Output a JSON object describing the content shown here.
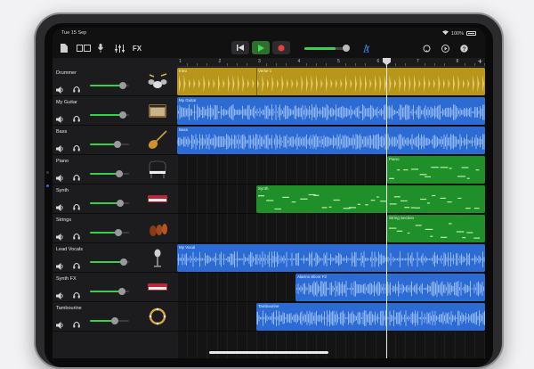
{
  "status": {
    "time": "Tue 15 Sep",
    "battery": "100%"
  },
  "toolbar": {
    "fx_label": "FX",
    "master_volume": 0.8,
    "colors": {
      "record": "#e5403a",
      "play": "#39d24a",
      "accent": "#2f6dd6"
    },
    "icons": [
      "document-icon",
      "view-toggle-icon",
      "microphone-icon",
      "mixer-icon",
      "rewind-icon",
      "play-icon",
      "record-icon",
      "metronome-icon",
      "loop-icon",
      "settings-icon",
      "help-icon"
    ]
  },
  "ruler": {
    "bars": [
      "1",
      "2",
      "3",
      "4",
      "5",
      "6",
      "7",
      "8"
    ]
  },
  "tracks": [
    {
      "name": "Drummer",
      "volume": 0.8,
      "icon": "drum-kit-icon",
      "color": "#b8961c"
    },
    {
      "name": "My Guitar",
      "volume": 0.8,
      "icon": "amp-icon",
      "color": "#2c6bd4"
    },
    {
      "name": "Bass",
      "volume": 0.65,
      "icon": "bass-guitar-icon",
      "color": "#2c6bd4"
    },
    {
      "name": "Piano",
      "volume": 0.7,
      "icon": "grand-piano-icon",
      "color": "#1f8f2a"
    },
    {
      "name": "Synth",
      "volume": 0.72,
      "icon": "synth-keyboard-icon",
      "color": "#1f8f2a"
    },
    {
      "name": "Strings",
      "volume": 0.68,
      "icon": "violin-icon",
      "color": "#1f8f2a"
    },
    {
      "name": "Lead Vocals",
      "volume": 0.82,
      "icon": "microphone-icon",
      "color": "#2c6bd4"
    },
    {
      "name": "Synth FX",
      "volume": 0.78,
      "icon": "synth-keyboard-icon",
      "color": "#2c6bd4"
    },
    {
      "name": "Tambourine",
      "volume": 0.6,
      "icon": "tambourine-icon",
      "color": "#2c6bd4"
    }
  ],
  "regions": {
    "drummer": [
      "Intro",
      "Verse 1"
    ],
    "guitar": "My Guitar",
    "bass": "Bass",
    "piano": "Piano",
    "synth": "Synth",
    "strings": "String Section",
    "vocals": "My Vocal",
    "synthfx": "Alarms Slicer F2",
    "tambourine": "Tambourine"
  }
}
